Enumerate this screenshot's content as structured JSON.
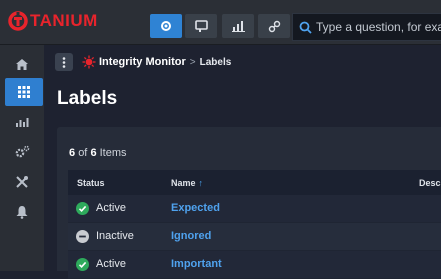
{
  "brand": {
    "name": "TANIUM",
    "color": "#e8242c"
  },
  "toolbar": {
    "buttons": [
      {
        "icon": "home-target-icon"
      },
      {
        "icon": "dashboard-icon"
      },
      {
        "icon": "bar-chart-icon"
      },
      {
        "icon": "link-icon"
      }
    ],
    "search_placeholder": "Type a question, for example"
  },
  "sidebar": {
    "items": [
      {
        "icon": "home-icon"
      },
      {
        "icon": "modules-grid-icon",
        "active": true
      },
      {
        "icon": "reports-icon"
      },
      {
        "icon": "admin-gears-icon"
      },
      {
        "icon": "tools-icon"
      },
      {
        "icon": "alerts-icon"
      }
    ]
  },
  "breadcrumb": {
    "module": "Integrity Monitor",
    "separator": ">",
    "page": "Labels"
  },
  "page": {
    "title": "Labels"
  },
  "table": {
    "count_current": "6",
    "count_word": "of",
    "count_total": "6",
    "count_suffix": "Items",
    "columns": {
      "status": "Status",
      "name": "Name",
      "description": "Desc"
    },
    "rows": [
      {
        "status": "Active",
        "name": "Expected"
      },
      {
        "status": "Inactive",
        "name": "Ignored"
      },
      {
        "status": "Active",
        "name": "Important"
      }
    ]
  },
  "colors": {
    "accent": "#2f83d4",
    "link": "#4fa2ee",
    "active": "#2eaa5c",
    "inactive": "#c9ccd1"
  }
}
